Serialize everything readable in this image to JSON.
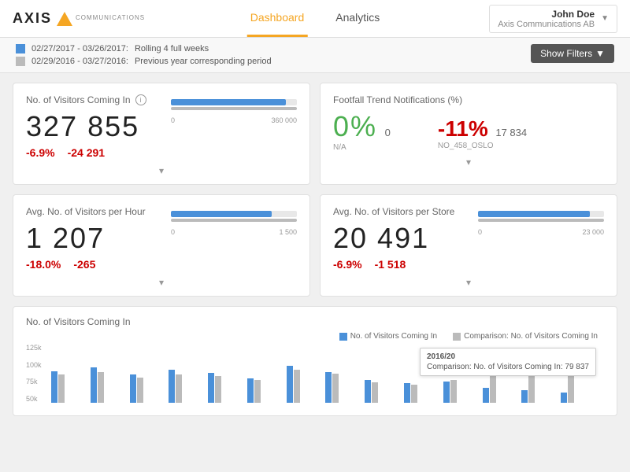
{
  "header": {
    "logo_text": "AXIS",
    "logo_sub": "COMMUNICATIONS",
    "nav": [
      {
        "label": "Dashboard",
        "active": true
      },
      {
        "label": "Analytics",
        "active": false
      }
    ],
    "user": {
      "name": "John Doe",
      "org": "Axis Communications AB"
    },
    "show_filters_label": "Show Filters"
  },
  "filter_bar": {
    "row1_date": "02/27/2017 - 03/26/2017:",
    "row1_desc": "Rolling 4 full weeks",
    "row2_date": "02/29/2016 - 03/27/2016:",
    "row2_desc": "Previous year corresponding period"
  },
  "cards": [
    {
      "id": "visitors-coming-in",
      "title": "No. of Visitors Coming In",
      "has_info": true,
      "main_value": "327 855",
      "change1": "-6.9%",
      "change2": "-24 291",
      "bar_blue_pct": 91,
      "bar_gray_pct": 100,
      "bar_min": "0",
      "bar_max": "360 000"
    },
    {
      "id": "footfall-trend",
      "title": "Footfall Trend Notifications (%)",
      "has_info": false,
      "green_value": "0%",
      "green_sub": "N/A",
      "green_count": "0",
      "red_value": "-11%",
      "red_sub": "NO_458_OSLO",
      "red_count": "17 834"
    },
    {
      "id": "avg-visitors-hour",
      "title": "Avg. No. of Visitors per Hour",
      "has_info": false,
      "main_value": "1 207",
      "change1": "-18.0%",
      "change2": "-265",
      "bar_blue_pct": 80,
      "bar_gray_pct": 100,
      "bar_min": "0",
      "bar_max": "1 500"
    },
    {
      "id": "avg-visitors-store",
      "title": "Avg. No. of Visitors per Store",
      "has_info": false,
      "main_value": "20 491",
      "change1": "-6.9%",
      "change2": "-1 518",
      "bar_blue_pct": 89,
      "bar_gray_pct": 100,
      "bar_min": "0",
      "bar_max": "23 000"
    }
  ],
  "bottom_chart": {
    "title": "No. of Visitors Coming In",
    "legend": [
      {
        "label": "No. of Visitors Coming In"
      },
      {
        "label": "Comparison: No. of Visitors Coming In"
      }
    ],
    "y_labels": [
      "125k",
      "100k",
      "75k",
      "50k"
    ],
    "bars": [
      {
        "blue": 62,
        "gray": 55
      },
      {
        "blue": 70,
        "gray": 60
      },
      {
        "blue": 55,
        "gray": 50
      },
      {
        "blue": 65,
        "gray": 55
      },
      {
        "blue": 58,
        "gray": 52
      },
      {
        "blue": 48,
        "gray": 44
      },
      {
        "blue": 72,
        "gray": 65
      },
      {
        "blue": 60,
        "gray": 57
      },
      {
        "blue": 45,
        "gray": 40
      },
      {
        "blue": 38,
        "gray": 35
      },
      {
        "blue": 42,
        "gray": 45
      },
      {
        "blue": 30,
        "gray": 60
      },
      {
        "blue": 25,
        "gray": 58
      },
      {
        "blue": 20,
        "gray": 55
      }
    ],
    "tooltip": {
      "title": "2016/20",
      "line": "Comparison: No. of Visitors Coming In: 79 837"
    }
  }
}
